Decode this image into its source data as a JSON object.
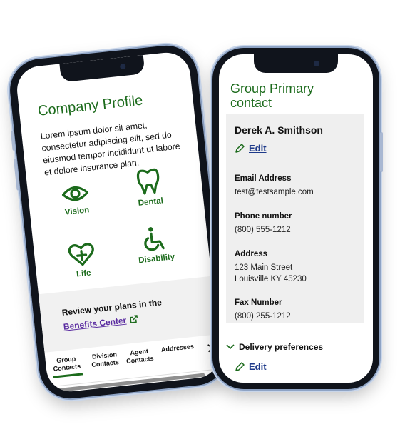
{
  "left_phone": {
    "title": "Company Profile",
    "description": "Lorem ipsum dolor sit amet, consectetur adipiscing elit, sed do eiusmod tempor incididunt ut labore et dolore insurance plan.",
    "plans": [
      {
        "label": "Vision",
        "icon": "eye-icon"
      },
      {
        "label": "Dental",
        "icon": "tooth-icon"
      },
      {
        "label": "Life",
        "icon": "heart-plus-icon"
      },
      {
        "label": "Disability",
        "icon": "wheelchair-icon"
      }
    ],
    "review_text": "Review your plans in the",
    "review_link": "Benefits Center",
    "tabs": [
      {
        "label": "Group Contacts",
        "active": true
      },
      {
        "label": "Division Contacts",
        "active": false
      },
      {
        "label": "Agent Contacts",
        "active": false
      },
      {
        "label": "Addresses",
        "active": false
      }
    ]
  },
  "right_phone": {
    "title": "Group Primary contact",
    "contact_name": "Derek A. Smithson",
    "edit_label": "Edit",
    "fields": [
      {
        "label": "Email Address",
        "value": "test@testsample.com"
      },
      {
        "label": "Phone number",
        "value": "(800) 555-1212"
      },
      {
        "label": "Address",
        "value": "123 Main Street\nLouisville KY 45230"
      },
      {
        "label": "Fax Number",
        "value": "(800) 255-1212"
      }
    ],
    "delivery_label": "Delivery preferences",
    "delivery_edit_label": "Edit"
  },
  "colors": {
    "brand_green": "#1c6b1c",
    "link_purple": "#5a2ca0",
    "link_blue": "#1e3a8a"
  }
}
